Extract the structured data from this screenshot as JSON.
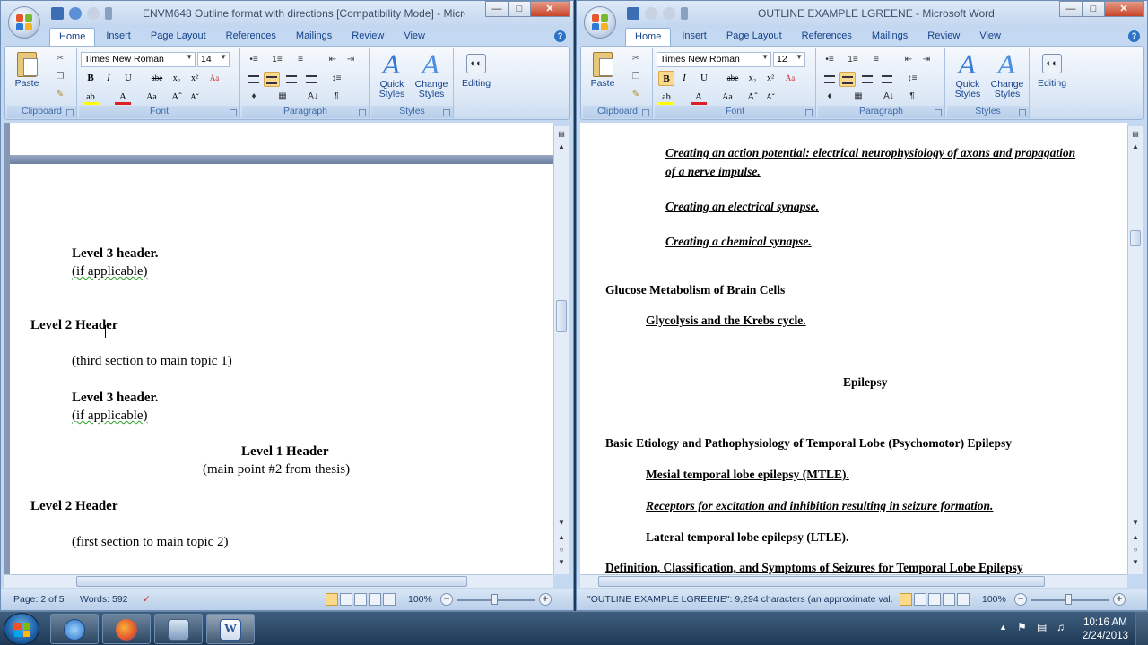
{
  "left_window": {
    "title": "ENVM648 Outline format with directions [Compatibility Mode] - Micro...",
    "tabs": [
      "Home",
      "Insert",
      "Page Layout",
      "References",
      "Mailings",
      "Review",
      "View"
    ],
    "font_name": "Times New Roman",
    "font_size": "14",
    "groups": {
      "clipboard": "Clipboard",
      "font": "Font",
      "paragraph": "Paragraph",
      "styles": "Styles"
    },
    "paste_label": "Paste",
    "quick_styles": "Quick Styles",
    "change_styles": "Change Styles",
    "editing": "Editing",
    "document": {
      "lines": [
        {
          "text": "Level 3 header.",
          "style": "bold"
        },
        {
          "text": "(if applicable)",
          "style": "normal"
        },
        {
          "text": "Level 2 Header",
          "style": "bold"
        },
        {
          "text": "(third section to main topic 1)",
          "style": "normal"
        },
        {
          "text": "Level 3 header.",
          "style": "bold"
        },
        {
          "text": "(if applicable)",
          "style": "normal"
        },
        {
          "text": "Level 1 Header",
          "style": "bold"
        },
        {
          "text": "(main point #2 from thesis)",
          "style": "normal"
        },
        {
          "text": "Level 2 Header",
          "style": "bold"
        },
        {
          "text": "(first section to main topic 2)",
          "style": "normal"
        }
      ]
    },
    "status": {
      "page": "Page: 2 of 5",
      "words": "Words: 592",
      "zoom": "100%"
    }
  },
  "right_window": {
    "title": "OUTLINE EXAMPLE LGREENE - Microsoft Word",
    "tabs": [
      "Home",
      "Insert",
      "Page Layout",
      "References",
      "Mailings",
      "Review",
      "View"
    ],
    "font_name": "Times New Roman",
    "font_size": "12",
    "groups": {
      "clipboard": "Clipboard",
      "font": "Font",
      "paragraph": "Paragraph",
      "styles": "Styles"
    },
    "paste_label": "Paste",
    "quick_styles": "Quick Styles",
    "change_styles": "Change Styles",
    "editing": "Editing",
    "document": {
      "lines": [
        "Creating an action potential: electrical neurophysiology of axons and propagation",
        "of a nerve impulse.",
        "Creating an electrical synapse.",
        "Creating a chemical synapse.",
        "Glucose Metabolism of Brain Cells",
        "Glycolysis and the Krebs cycle.",
        "Epilepsy",
        "Basic Etiology and Pathophysiology of Temporal Lobe (Psychomotor) Epilepsy",
        "Mesial temporal lobe epilepsy (MTLE).",
        "Receptors for excitation and inhibition resulting in seizure formation.",
        "Lateral temporal lobe epilepsy (LTLE).",
        "Definition, Classification, and Symptoms of Seizures for Temporal Lobe Epilepsy"
      ]
    },
    "status": {
      "info": "\"OUTLINE EXAMPLE LGREENE\": 9,294 characters (an approximate val...",
      "zoom": "100%"
    }
  },
  "taskbar": {
    "time": "10:16 AM",
    "date": "2/24/2013",
    "apps": [
      "itunes-icon",
      "firefox-icon",
      "video-icon",
      "word-icon"
    ]
  },
  "colors": {
    "ribbon_text": "#15428b",
    "active_button": "#fbd98a",
    "taskbar": "#1d3855"
  }
}
